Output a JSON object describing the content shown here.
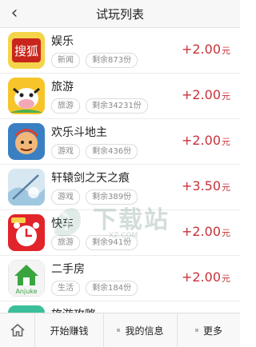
{
  "navbar": {
    "title": "试玩列表",
    "back_icon": "chevron-left-icon"
  },
  "apps": [
    {
      "name": "娱乐",
      "category": "新闻",
      "remaining": "剩余873份",
      "reward": "+2.00",
      "unit": "元",
      "icon": "sohu-fox-icon",
      "icon_color": "#c8261c"
    },
    {
      "name": "旅游",
      "category": "旅游",
      "remaining": "剩余34231份",
      "reward": "+2.00",
      "unit": "元",
      "icon": "cow-travel-icon",
      "icon_color": "#f7c52a"
    },
    {
      "name": "欢乐斗地主",
      "category": "游戏",
      "remaining": "剩余436份",
      "reward": "+2.00",
      "unit": "元",
      "icon": "landlord-game-icon",
      "icon_color": "#e98a2b"
    },
    {
      "name": "轩辕剑之天之痕",
      "category": "游戏",
      "remaining": "剩余389份",
      "reward": "+3.50",
      "unit": "元",
      "icon": "sword-game-icon",
      "icon_color": "#9fc7e0"
    },
    {
      "name": "快车",
      "category": "旅游",
      "remaining": "剩余941份",
      "reward": "+2.00",
      "unit": "元",
      "icon": "alarm-clock-icon",
      "icon_color": "#e1242a"
    },
    {
      "name": "二手房",
      "category": "生活",
      "remaining": "剩余184份",
      "reward": "+2.00",
      "unit": "元",
      "icon": "anjuke-house-icon",
      "icon_color": "#3aa53f",
      "icon_text": "Anjuke"
    },
    {
      "name": "旅游攻略",
      "category": "",
      "remaining": "",
      "reward": "",
      "unit": "",
      "icon": "travel-guide-icon",
      "icon_color": "#3bbf9a"
    }
  ],
  "watermark": {
    "text": "下载站",
    "url": "XZ.COM"
  },
  "tabbar": {
    "home_icon": "home-icon",
    "start": "开始赚钱",
    "info": "我的信息",
    "more": "更多"
  },
  "colors": {
    "reward": "#c7323a",
    "navbar_bg": "#f7f7f7"
  }
}
